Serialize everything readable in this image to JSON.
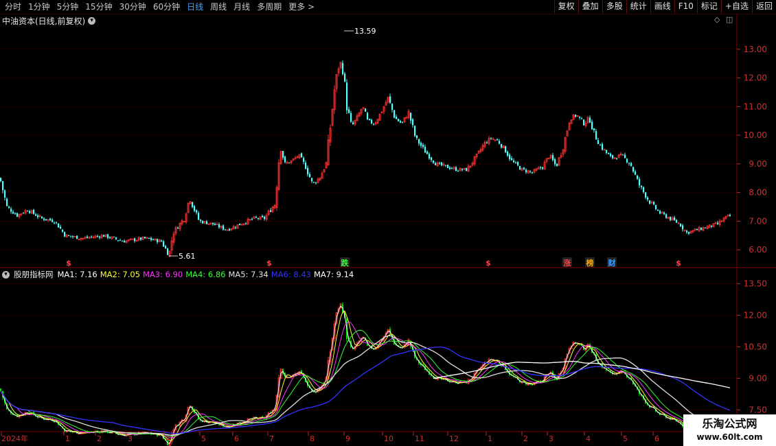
{
  "toolbar": {
    "tabs": [
      "分时",
      "1分钟",
      "5分钟",
      "15分钟",
      "30分钟",
      "60分钟",
      "日线",
      "周线",
      "月线",
      "多周期",
      "更多 >"
    ],
    "active": "日线",
    "buttons": [
      "复权",
      "叠加",
      "多股",
      "统计",
      "画线",
      "F10",
      "标记",
      "+自选",
      "返回"
    ]
  },
  "main_title": "中油资本(日线,前复权)",
  "annotations": {
    "high": "13.59",
    "low": "5.61"
  },
  "event_markers": [
    "$",
    "$",
    "跌",
    "$",
    "涨",
    "榜",
    "财",
    "$"
  ],
  "indicator": {
    "name": "股朋指标网",
    "ma": [
      {
        "label": "MA1:",
        "value": "7.16",
        "color": "#ffffff"
      },
      {
        "label": "MA2:",
        "value": "7.05",
        "color": "#ffff33"
      },
      {
        "label": "MA3:",
        "value": "6.90",
        "color": "#ff33ff"
      },
      {
        "label": "MA4:",
        "value": "6.86",
        "color": "#33ff33"
      },
      {
        "label": "MA5:",
        "value": "7.34",
        "color": "#e0e0e0"
      },
      {
        "label": "MA6:",
        "value": "8.43",
        "color": "#3333ff"
      },
      {
        "label": "MA7:",
        "value": "9.14",
        "color": "#ffffff"
      }
    ]
  },
  "watermark": {
    "line1": "乐淘公式网",
    "line2": "www.60lt.com"
  },
  "chart_data": [
    {
      "type": "candlestick",
      "ylim": [
        5.5,
        14.0
      ],
      "yticks": [
        "13.00",
        "12.00",
        "11.00",
        "10.00",
        "9.00",
        "8.00",
        "7.00",
        "6.00"
      ],
      "close_path": [
        [
          0,
          8.5
        ],
        [
          10,
          7.5
        ],
        [
          25,
          7.2
        ],
        [
          40,
          7.4
        ],
        [
          60,
          7.1
        ],
        [
          80,
          7.0
        ],
        [
          95,
          6.5
        ],
        [
          120,
          6.4
        ],
        [
          150,
          6.5
        ],
        [
          180,
          6.3
        ],
        [
          210,
          6.4
        ],
        [
          235,
          6.3
        ],
        [
          246,
          5.8
        ],
        [
          252,
          6.6
        ],
        [
          268,
          7.1
        ],
        [
          276,
          7.8
        ],
        [
          290,
          7.0
        ],
        [
          310,
          6.9
        ],
        [
          330,
          6.7
        ],
        [
          350,
          6.9
        ],
        [
          370,
          7.1
        ],
        [
          385,
          7.1
        ],
        [
          400,
          7.6
        ],
        [
          408,
          9.6
        ],
        [
          415,
          9.0
        ],
        [
          425,
          9.1
        ],
        [
          435,
          9.3
        ],
        [
          445,
          8.9
        ],
        [
          455,
          8.3
        ],
        [
          465,
          8.5
        ],
        [
          475,
          9.0
        ],
        [
          482,
          10.5
        ],
        [
          488,
          11.8
        ],
        [
          495,
          12.6
        ],
        [
          500,
          12.2
        ],
        [
          505,
          11.0
        ],
        [
          512,
          10.3
        ],
        [
          520,
          10.6
        ],
        [
          528,
          11.0
        ],
        [
          535,
          10.5
        ],
        [
          545,
          10.4
        ],
        [
          555,
          10.8
        ],
        [
          565,
          11.3
        ],
        [
          575,
          10.6
        ],
        [
          585,
          10.4
        ],
        [
          595,
          10.8
        ],
        [
          605,
          9.9
        ],
        [
          620,
          9.4
        ],
        [
          635,
          9.0
        ],
        [
          650,
          8.9
        ],
        [
          665,
          8.8
        ],
        [
          680,
          8.8
        ],
        [
          695,
          9.3
        ],
        [
          705,
          9.7
        ],
        [
          715,
          9.9
        ],
        [
          725,
          9.8
        ],
        [
          735,
          9.5
        ],
        [
          745,
          9.1
        ],
        [
          760,
          8.8
        ],
        [
          775,
          8.7
        ],
        [
          790,
          8.9
        ],
        [
          800,
          9.3
        ],
        [
          810,
          8.9
        ],
        [
          820,
          9.6
        ],
        [
          830,
          10.6
        ],
        [
          840,
          10.7
        ],
        [
          850,
          10.4
        ],
        [
          858,
          10.6
        ],
        [
          866,
          10.0
        ],
        [
          875,
          9.6
        ],
        [
          890,
          9.2
        ],
        [
          905,
          9.3
        ],
        [
          918,
          9.0
        ],
        [
          930,
          8.3
        ],
        [
          945,
          7.7
        ],
        [
          960,
          7.3
        ],
        [
          975,
          7.1
        ],
        [
          990,
          6.9
        ],
        [
          1000,
          6.6
        ],
        [
          1015,
          6.7
        ],
        [
          1030,
          6.8
        ],
        [
          1045,
          6.9
        ],
        [
          1055,
          7.1
        ],
        [
          1065,
          7.2
        ]
      ]
    },
    {
      "type": "line",
      "series": [
        {
          "name": "MA1",
          "color": "#ffffff"
        },
        {
          "name": "MA2",
          "color": "#ffff33"
        },
        {
          "name": "MA3",
          "color": "#ff33ff"
        },
        {
          "name": "MA4",
          "color": "#33ff33"
        },
        {
          "name": "MA5",
          "color": "#e0e0e0"
        },
        {
          "name": "MA6",
          "color": "#3333ff"
        },
        {
          "name": "MA7",
          "color": "#ffffff"
        }
      ],
      "yticks": [
        "13.50",
        "12.00",
        "10.50",
        "9.00",
        "7.50"
      ],
      "xticks": [
        "2024年",
        "1",
        "2",
        "3",
        "4",
        "5",
        "6",
        "7",
        "8",
        "9",
        "10",
        "11",
        "12",
        "1",
        "2",
        "3",
        "4",
        "5",
        "6"
      ]
    }
  ]
}
